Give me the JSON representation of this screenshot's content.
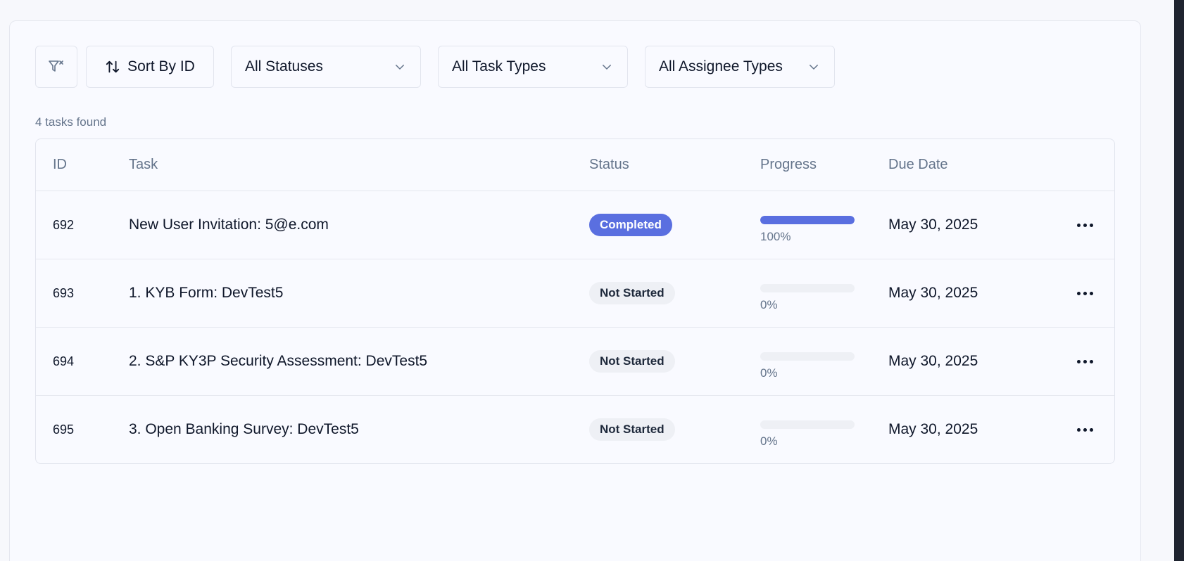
{
  "toolbar": {
    "clear_filter_icon": "filter-clear-icon",
    "sort_label": "Sort By ID",
    "status_select": "All Statuses",
    "task_type_select": "All Task Types",
    "assignee_type_select": "All Assignee Types"
  },
  "summary": {
    "count_text": "4 tasks found"
  },
  "table": {
    "headers": {
      "id": "ID",
      "task": "Task",
      "status": "Status",
      "progress": "Progress",
      "due": "Due Date"
    },
    "rows": [
      {
        "id": "692",
        "task": "New User Invitation: 5@e.com",
        "status": "Completed",
        "progress": 1.0,
        "progress_text": "100%",
        "due": "May 30, 2025"
      },
      {
        "id": "693",
        "task": "1. KYB Form: DevTest5",
        "status": "Not Started",
        "progress": 0.0,
        "progress_text": "0%",
        "due": "May 30, 2025"
      },
      {
        "id": "694",
        "task": "2. S&P KY3P Security Assessment: DevTest5",
        "status": "Not Started",
        "progress": 0.0,
        "progress_text": "0%",
        "due": "May 30, 2025"
      },
      {
        "id": "695",
        "task": "3. Open Banking Survey: DevTest5",
        "status": "Not Started",
        "progress": 0.0,
        "progress_text": "0%",
        "due": "May 30, 2025"
      }
    ]
  },
  "colors": {
    "accent": "#5a6fe0",
    "muted_text": "#64748b",
    "badge_neutral": "#eef0f5"
  }
}
